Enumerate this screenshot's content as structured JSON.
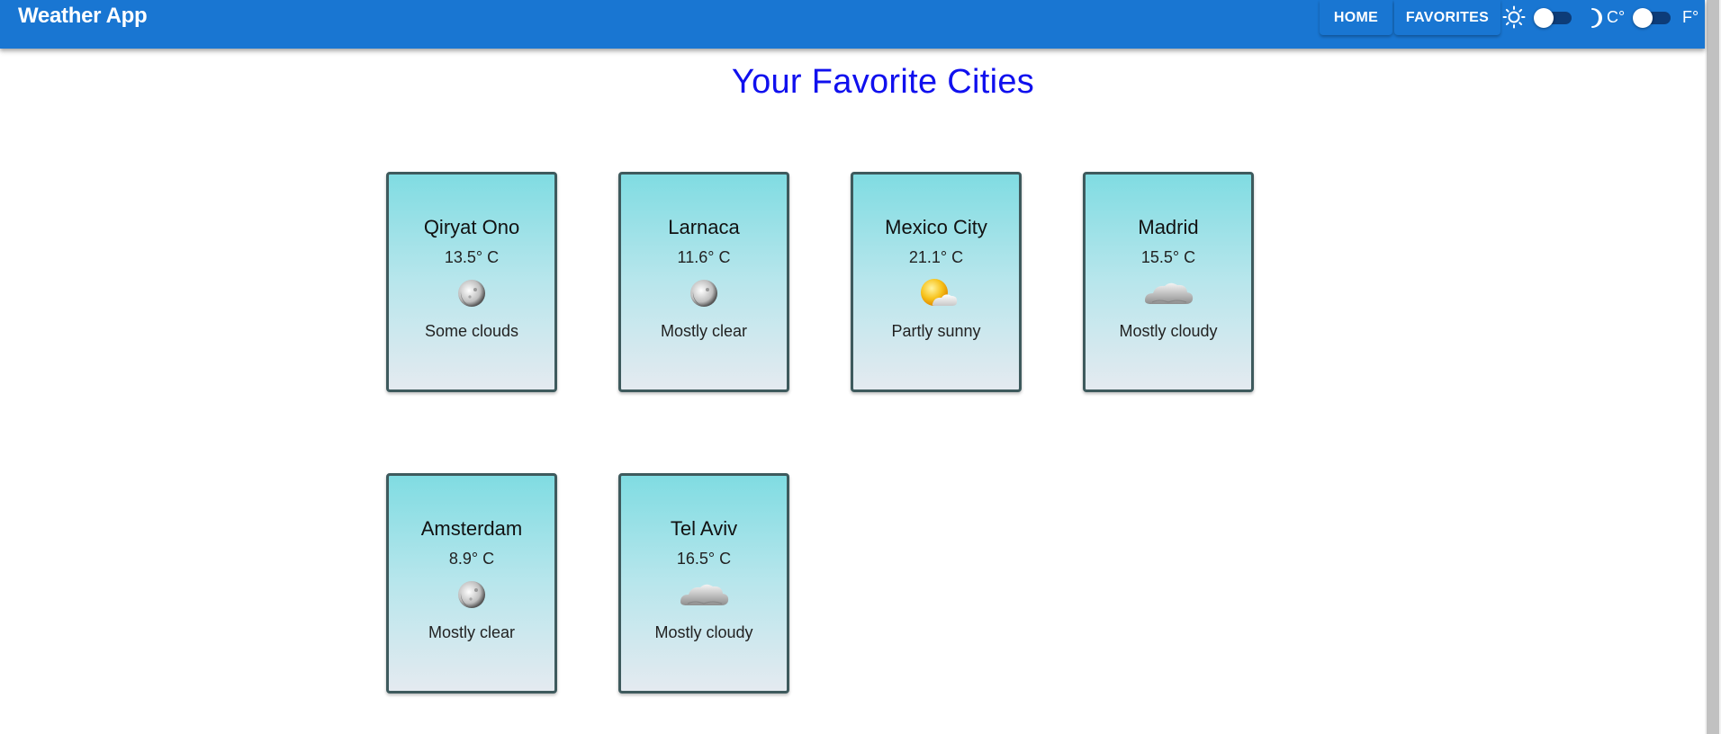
{
  "header": {
    "title": "Weather App",
    "nav": {
      "home_label": "HOME",
      "favorites_label": "FAVORITES"
    },
    "theme_toggle": {
      "left_icon": "sun-icon",
      "right_icon": "moon-icon",
      "checked": false
    },
    "unit_toggle": {
      "left_label": "C°",
      "right_label": "F°",
      "checked": false
    },
    "colors": {
      "appbar": "#1976d2",
      "title_text": "#1010ee"
    }
  },
  "main": {
    "title": "Your Favorite Cities",
    "cards": [
      {
        "city": "Qiryat Ono",
        "temp": "13.5° C",
        "icon": "moon-cloud-icon",
        "desc": "Some clouds"
      },
      {
        "city": "Larnaca",
        "temp": "11.6° C",
        "icon": "moon-cloud-icon",
        "desc": "Mostly clear"
      },
      {
        "city": "Mexico City",
        "temp": "21.1° C",
        "icon": "sun-cloud-icon",
        "desc": "Partly sunny"
      },
      {
        "city": "Madrid",
        "temp": "15.5° C",
        "icon": "cloud-icon",
        "desc": "Mostly cloudy"
      },
      {
        "city": "Amsterdam",
        "temp": "8.9° C",
        "icon": "moon-icon",
        "desc": "Mostly clear"
      },
      {
        "city": "Tel Aviv",
        "temp": "16.5° C",
        "icon": "cloud-icon",
        "desc": "Mostly cloudy"
      }
    ]
  }
}
